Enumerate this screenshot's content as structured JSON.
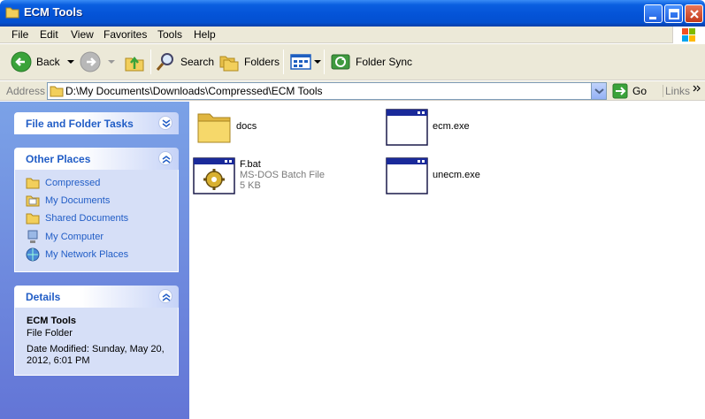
{
  "window": {
    "title": "ECM Tools"
  },
  "menu": [
    "File",
    "Edit",
    "View",
    "Favorites",
    "Tools",
    "Help"
  ],
  "toolbar": {
    "back_label": "Back",
    "search_label": "Search",
    "folders_label": "Folders",
    "folder_sync_label": "Folder Sync"
  },
  "address": {
    "label": "Address",
    "path": "D:\\My Documents\\Downloads\\Compressed\\ECM Tools",
    "go_label": "Go",
    "links_label": "Links"
  },
  "tasks": {
    "file_folder_tasks": "File and Folder Tasks",
    "other_places": "Other Places",
    "places": [
      "Compressed",
      "My Documents",
      "Shared Documents",
      "My Computer",
      "My Network Places"
    ],
    "details_title": "Details",
    "details_name": "ECM Tools",
    "details_type": "File Folder",
    "details_modified_1": "Date Modified: Sunday, May 20,",
    "details_modified_2": "2012, 6:01 PM"
  },
  "files": [
    {
      "name": "docs",
      "kind": "folder"
    },
    {
      "name": "ecm.exe",
      "kind": "exe"
    },
    {
      "name": "F.bat",
      "kind": "bat",
      "type": "MS-DOS Batch File",
      "size": "5 KB"
    },
    {
      "name": "unecm.exe",
      "kind": "exe"
    }
  ],
  "colors": {
    "titlebar": "#0554d8",
    "link_blue": "#215dc6",
    "panel_top": "#7ba2e7",
    "panel_bottom": "#6375d6"
  }
}
